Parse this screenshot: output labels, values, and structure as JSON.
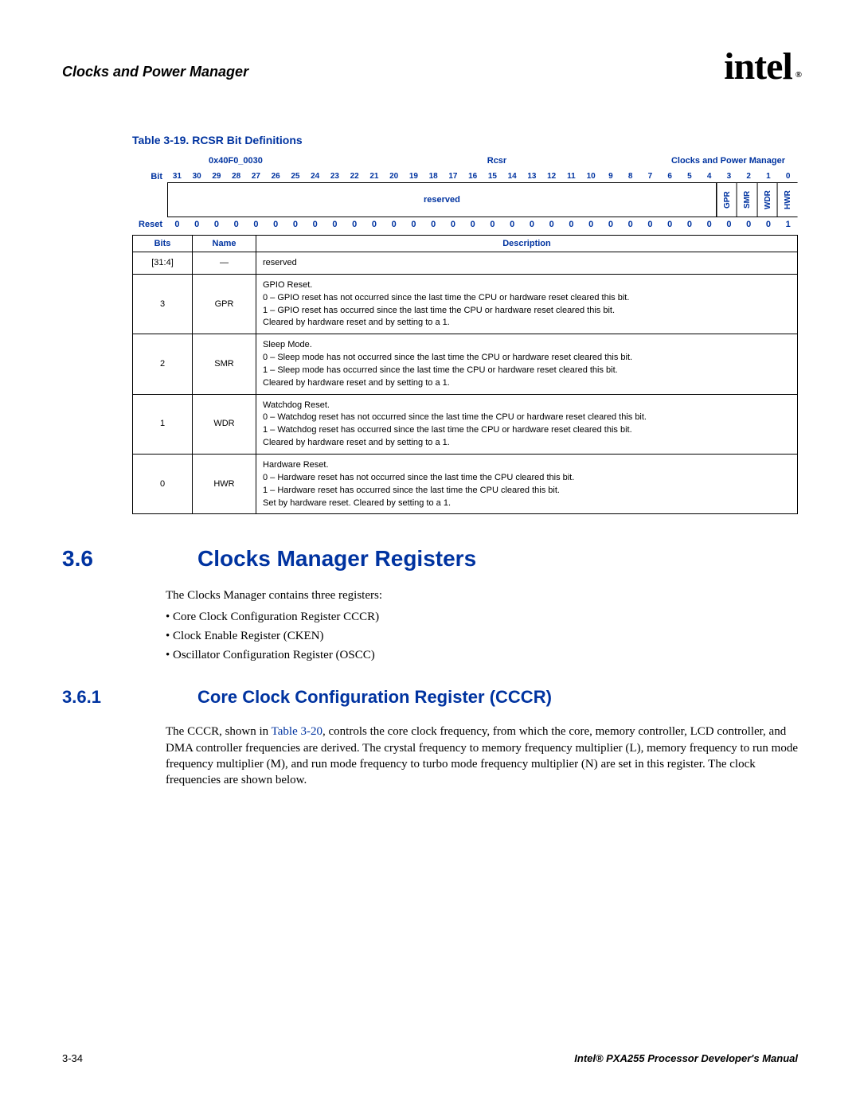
{
  "header": {
    "chapter": "Clocks and Power Manager",
    "logo_text": "intel",
    "logo_reg": "®"
  },
  "table_caption": "Table 3-19. RCSR Bit Definitions",
  "reg": {
    "address": "0x40F0_0030",
    "name": "Rcsr",
    "module": "Clocks and Power Manager",
    "bit_label": "Bit",
    "reset_label": "Reset",
    "bits": [
      "31",
      "30",
      "29",
      "28",
      "27",
      "26",
      "25",
      "24",
      "23",
      "22",
      "21",
      "20",
      "19",
      "18",
      "17",
      "16",
      "15",
      "14",
      "13",
      "12",
      "11",
      "10",
      "9",
      "8",
      "7",
      "6",
      "5",
      "4",
      "3",
      "2",
      "1",
      "0"
    ],
    "reserved_label": "reserved",
    "fields": [
      "GPR",
      "SMR",
      "WDR",
      "HWR"
    ],
    "reset_vals": [
      "0",
      "0",
      "0",
      "0",
      "0",
      "0",
      "0",
      "0",
      "0",
      "0",
      "0",
      "0",
      "0",
      "0",
      "0",
      "0",
      "0",
      "0",
      "0",
      "0",
      "0",
      "0",
      "0",
      "0",
      "0",
      "0",
      "0",
      "0",
      "0",
      "0",
      "0",
      "1"
    ]
  },
  "desc_headers": {
    "bits": "Bits",
    "name": "Name",
    "desc": "Description"
  },
  "rows": [
    {
      "bits": "[31:4]",
      "name": "—",
      "desc_lines": [
        "reserved"
      ]
    },
    {
      "bits": "3",
      "name": "GPR",
      "desc_lines": [
        "GPIO Reset.",
        "0 – GPIO reset has not occurred since the last time the CPU or hardware reset cleared this bit.",
        "1 – GPIO reset has occurred since the last time the CPU or hardware reset cleared this bit.",
        "Cleared by hardware reset and by setting to a 1."
      ]
    },
    {
      "bits": "2",
      "name": "SMR",
      "desc_lines": [
        "Sleep Mode.",
        "0 – Sleep mode has not occurred since the last time the CPU or hardware reset cleared this bit.",
        "1 – Sleep mode has occurred since the last time the CPU or hardware reset cleared this bit.",
        "Cleared by hardware reset and by setting to a 1."
      ]
    },
    {
      "bits": "1",
      "name": "WDR",
      "desc_lines": [
        "Watchdog Reset.",
        "0 – Watchdog reset has not occurred since the last time the CPU or hardware reset cleared this bit.",
        "1 – Watchdog reset has occurred since the last time the CPU or hardware reset cleared this bit.",
        "Cleared by hardware reset and by setting to a 1."
      ]
    },
    {
      "bits": "0",
      "name": "HWR",
      "desc_lines": [
        "Hardware Reset.",
        "0 – Hardware reset has not occurred since the last time the CPU cleared this bit.",
        "1 – Hardware reset has occurred since the last time the CPU cleared this bit.",
        "Set by hardware reset. Cleared by setting to a 1."
      ]
    }
  ],
  "section36": {
    "num": "3.6",
    "title": "Clocks Manager Registers",
    "intro": "The Clocks Manager contains three registers:",
    "items": [
      "Core Clock Configuration Register CCCR)",
      "Clock Enable Register (CKEN)",
      "Oscillator Configuration Register (OSCC)"
    ]
  },
  "section361": {
    "num": "3.6.1",
    "title": "Core Clock Configuration Register (CCCR)",
    "body_pre": "The CCCR, shown in ",
    "link": "Table 3-20",
    "body_post": ", controls the core clock frequency, from which the core, memory controller, LCD controller, and DMA controller frequencies are derived. The crystal frequency to memory frequency multiplier (L), memory frequency to run mode frequency multiplier (M), and run mode frequency to turbo mode frequency multiplier (N) are set in this register. The clock frequencies are shown below."
  },
  "footer": {
    "page": "3-34",
    "manual": "Intel® PXA255 Processor Developer's Manual"
  }
}
